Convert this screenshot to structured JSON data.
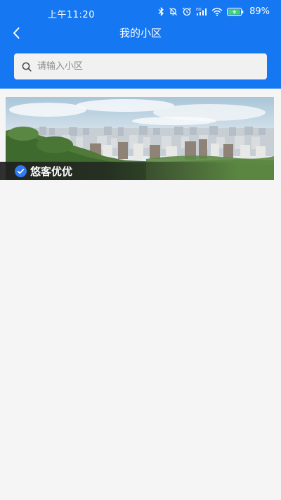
{
  "status_bar": {
    "time": "上午11:20",
    "battery": "89%",
    "network_label": "HD",
    "icons": [
      "bluetooth-icon",
      "silent-bell-icon",
      "alarm-icon",
      "signal-icon",
      "wifi-icon",
      "battery-charging-icon"
    ]
  },
  "header": {
    "title": "我的小区",
    "back_icon": "chevron-left-icon"
  },
  "search": {
    "placeholder": "请输入小区",
    "value": "",
    "icon": "search-icon"
  },
  "community": {
    "name": "悠客优优",
    "selected_icon": "check-circle-icon",
    "image": "city-skyline-photo"
  },
  "colors": {
    "primary": "#1577f2",
    "background": "#f5f5f5",
    "search_bg": "#f1f1f1",
    "check": "#2f7bf2"
  }
}
